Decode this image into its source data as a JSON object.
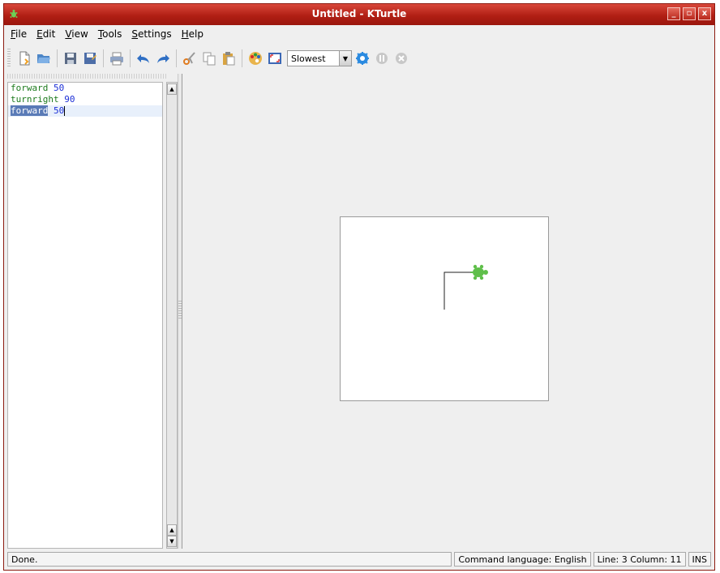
{
  "window": {
    "title": "Untitled - KTurtle",
    "controls": [
      "_",
      "▫",
      "x"
    ]
  },
  "menu": [
    {
      "label": "File",
      "mnemonic": "F"
    },
    {
      "label": "Edit",
      "mnemonic": "E"
    },
    {
      "label": "View",
      "mnemonic": "V"
    },
    {
      "label": "Tools",
      "mnemonic": "T"
    },
    {
      "label": "Settings",
      "mnemonic": "S"
    },
    {
      "label": "Help",
      "mnemonic": "H"
    }
  ],
  "toolbar": {
    "speed": {
      "selected": "Slowest"
    },
    "icons": [
      "new-file-icon",
      "open-file-icon",
      "save-icon",
      "save-as-icon",
      "print-icon",
      "undo-icon",
      "redo-icon",
      "cut-icon",
      "copy-icon",
      "paste-icon",
      "color-picker-icon",
      "fullscreen-icon",
      "run-icon",
      "pause-icon",
      "stop-icon"
    ]
  },
  "editor": {
    "lines": [
      {
        "keyword": "forward",
        "number": "50"
      },
      {
        "keyword": "turnright",
        "number": "90"
      },
      {
        "keyword": "forward",
        "number": "50"
      }
    ]
  },
  "status": {
    "message": "Done.",
    "language": "Command language: English",
    "position": "Line: 3 Column: 11",
    "mode": "INS"
  },
  "colors": {
    "titlebar": "#b11f14",
    "keyword": "#1c7a1c",
    "number": "#1c2fd6",
    "turtle": "#5fbf4a"
  }
}
